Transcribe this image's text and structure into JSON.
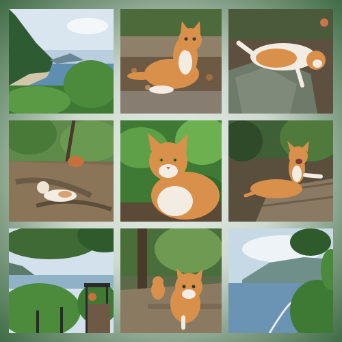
{
  "collage": {
    "tiles": [
      {
        "id": "coastal-cliff-view"
      },
      {
        "id": "cat-sitting-on-leaves"
      },
      {
        "id": "cat-lying-on-rock"
      },
      {
        "id": "cat-on-forest-path"
      },
      {
        "id": "cat-closeup-foliage"
      },
      {
        "id": "cat-on-log"
      },
      {
        "id": "coast-from-lookout"
      },
      {
        "id": "cats-on-trail"
      },
      {
        "id": "sea-and-mountains"
      }
    ],
    "colors": {
      "border_light": "#e9efe8",
      "border_green": "#3f6b45",
      "cat_orange": "#d9904a",
      "cat_white": "#f3ece2",
      "sea_blue": "#5f8fb0",
      "foliage_green": "#3f7a34"
    }
  }
}
